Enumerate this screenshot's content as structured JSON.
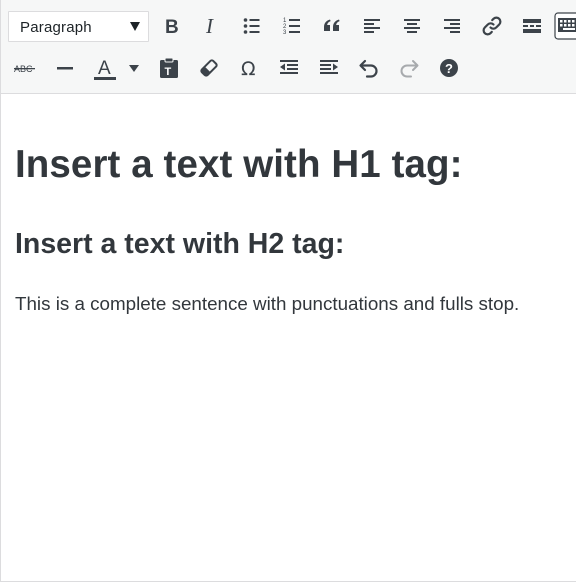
{
  "toolbar": {
    "format_select": {
      "value": "Paragraph"
    },
    "row1_buttons": [
      {
        "name": "bold-button",
        "icon": "bold-icon"
      },
      {
        "name": "italic-button",
        "icon": "italic-icon"
      },
      {
        "name": "bulleted-list-button",
        "icon": "bulleted-list-icon"
      },
      {
        "name": "numbered-list-button",
        "icon": "numbered-list-icon"
      },
      {
        "name": "blockquote-button",
        "icon": "blockquote-icon"
      },
      {
        "name": "align-left-button",
        "icon": "align-left-icon"
      },
      {
        "name": "align-center-button",
        "icon": "align-center-icon"
      },
      {
        "name": "align-right-button",
        "icon": "align-right-icon"
      },
      {
        "name": "insert-link-button",
        "icon": "link-icon"
      },
      {
        "name": "read-more-button",
        "icon": "read-more-icon"
      },
      {
        "name": "toolbar-toggle-button",
        "icon": "keyboard-icon"
      }
    ],
    "row2_buttons": [
      {
        "name": "strikethrough-button",
        "icon": "strikethrough-icon",
        "label": "ABC"
      },
      {
        "name": "horizontal-line-button",
        "icon": "horizontal-line-icon"
      },
      {
        "name": "text-color-button",
        "icon": "text-color-icon",
        "label": "A"
      },
      {
        "name": "text-color-dropdown-button",
        "icon": "chevron-down-icon"
      },
      {
        "name": "paste-as-text-button",
        "icon": "clipboard-icon"
      },
      {
        "name": "clear-formatting-button",
        "icon": "eraser-icon"
      },
      {
        "name": "special-character-button",
        "icon": "omega-icon",
        "label": "Ω"
      },
      {
        "name": "decrease-indent-button",
        "icon": "outdent-icon"
      },
      {
        "name": "increase-indent-button",
        "icon": "indent-icon"
      },
      {
        "name": "undo-button",
        "icon": "undo-icon"
      },
      {
        "name": "redo-button",
        "icon": "redo-icon"
      },
      {
        "name": "help-button",
        "icon": "help-icon",
        "label": "?"
      }
    ]
  },
  "content": {
    "h1": "Insert a text with H1 tag:",
    "h2": "Insert a text with H2 tag:",
    "paragraph": "This is a complete sentence with punctuations and fulls stop."
  },
  "colors": {
    "icon": "#3c434a",
    "toolbar_bg": "#f6f7f7",
    "border": "#dcdcde",
    "text": "#32373c",
    "redo_disabled": "#a7aaad"
  }
}
